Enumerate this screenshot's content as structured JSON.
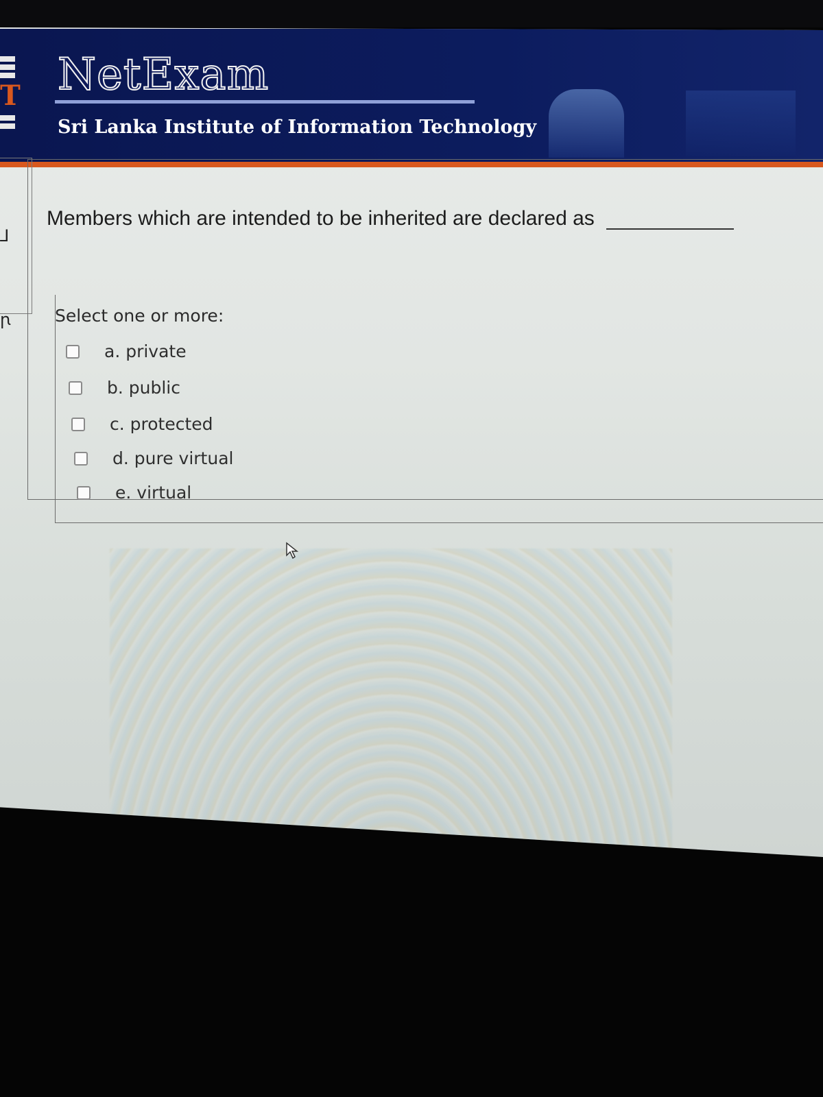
{
  "header": {
    "brand": "NetExam",
    "organization": "Sri Lanka Institute of Information Technology",
    "logo_letter": "T"
  },
  "question": {
    "text": "Members which are intended to be inherited are declared as",
    "prompt": "Select one or more:",
    "options": [
      {
        "label": "a. private",
        "checked": false
      },
      {
        "label": "b. public",
        "checked": false
      },
      {
        "label": "c. protected",
        "checked": false
      },
      {
        "label": "d. pure virtual",
        "checked": false
      },
      {
        "label": "e. virtual",
        "checked": false
      }
    ]
  },
  "colors": {
    "header_bg": "#0c1c5e",
    "accent_underline": "#d8581e"
  }
}
